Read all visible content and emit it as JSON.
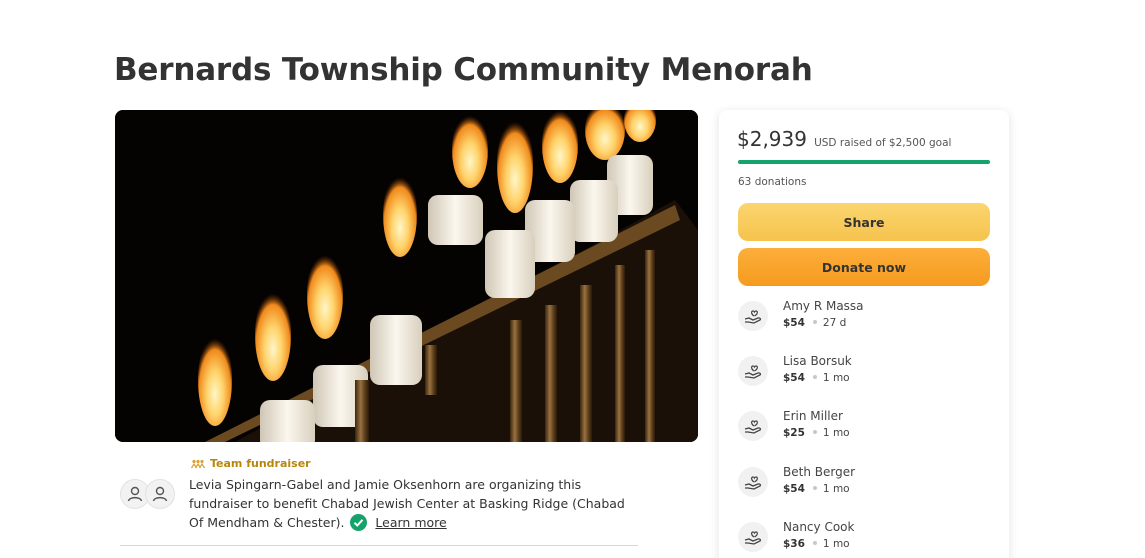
{
  "page": {
    "title": "Bernards Township Community Menorah"
  },
  "hero": {
    "image_label": "menorah-candles-photo"
  },
  "organizer": {
    "team_label": "Team fundraiser",
    "description": "Levia Spingarn-Gabel and Jamie Oksenhorn are organizing this fundraiser to benefit Chabad Jewish Center at Basking Ridge (Chabad Of Mendham & Chester).",
    "learn_more": "Learn more"
  },
  "donation_panel": {
    "raised_amount": "$2,939",
    "raised_suffix": "USD raised of $2,500 goal",
    "progress_fraction": 1.0,
    "donations_count": "63 donations",
    "share_label": "Share",
    "donate_label": "Donate now",
    "accent_color": "#15a36b"
  },
  "donors": [
    {
      "name": "Amy R Massa",
      "amount": "$54",
      "time": "27 d"
    },
    {
      "name": "Lisa Borsuk",
      "amount": "$54",
      "time": "1 mo"
    },
    {
      "name": "Erin Miller",
      "amount": "$25",
      "time": "1 mo"
    },
    {
      "name": "Beth Berger",
      "amount": "$54",
      "time": "1 mo"
    },
    {
      "name": "Nancy Cook",
      "amount": "$36",
      "time": "1 mo"
    }
  ]
}
